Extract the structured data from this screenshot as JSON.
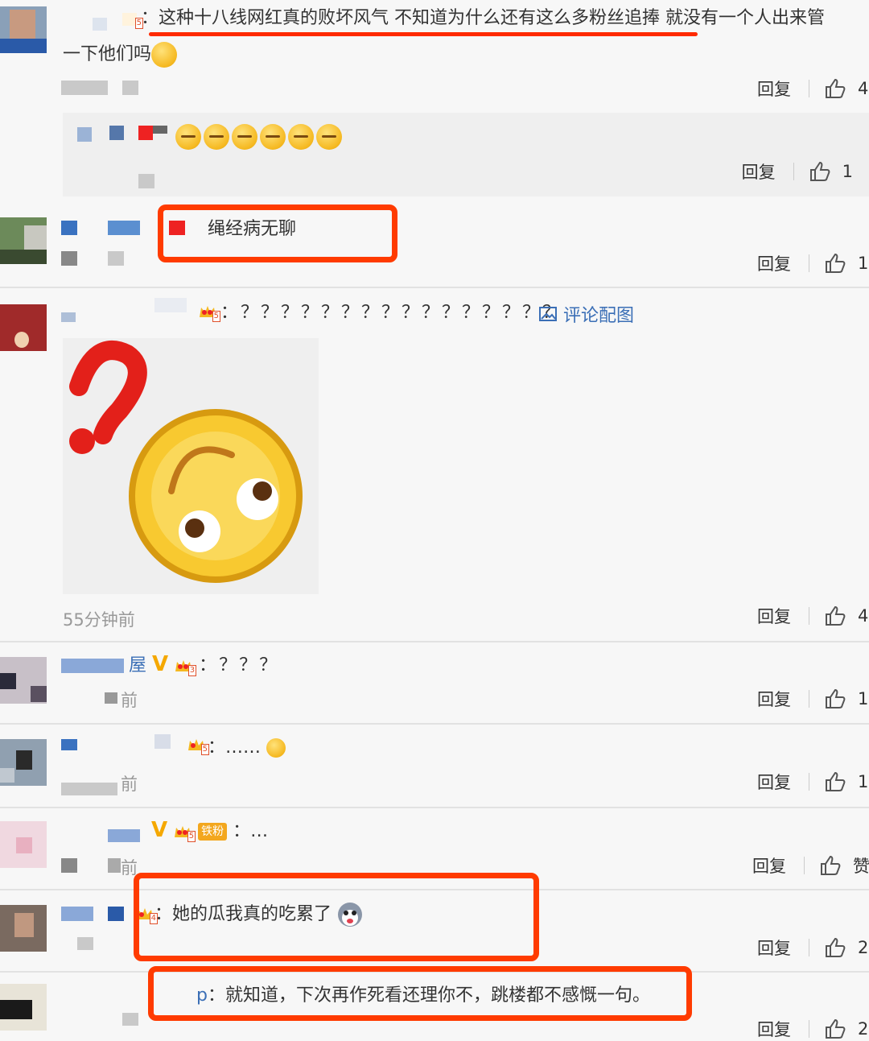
{
  "labels": {
    "reply": "回复",
    "comment_image_link": "评论配图"
  },
  "comments": [
    {
      "text_line1": "：这种十八线网红真的败坏风气 不知道为什么还有这么多粉丝追捧 就没有一个人出来管",
      "text_line2": "一下他们吗",
      "likes": "4"
    },
    {
      "nested_reply_likes": "1"
    },
    {
      "text": "绳经病无聊",
      "likes": "1"
    },
    {
      "text": "：？？？？？？？？？？？？？？？？",
      "time": "55分钟前",
      "likes": "4"
    },
    {
      "name_suffix": "屋",
      "text": "：？？？",
      "time": "前",
      "likes": "1"
    },
    {
      "text": "：……",
      "time": "前",
      "likes": "1"
    },
    {
      "badge": "铁粉",
      "text": "：…",
      "time": "前",
      "likes": "赞"
    },
    {
      "text": "：她的瓜我真的吃累了",
      "likes": "2"
    },
    {
      "name_suffix": "p",
      "text": "：就知道，下次再作死看还理你不，跳楼都不感慨一句。",
      "likes": "2"
    }
  ],
  "accent_color": "#ff3b00",
  "link_color": "#3b6fb6"
}
